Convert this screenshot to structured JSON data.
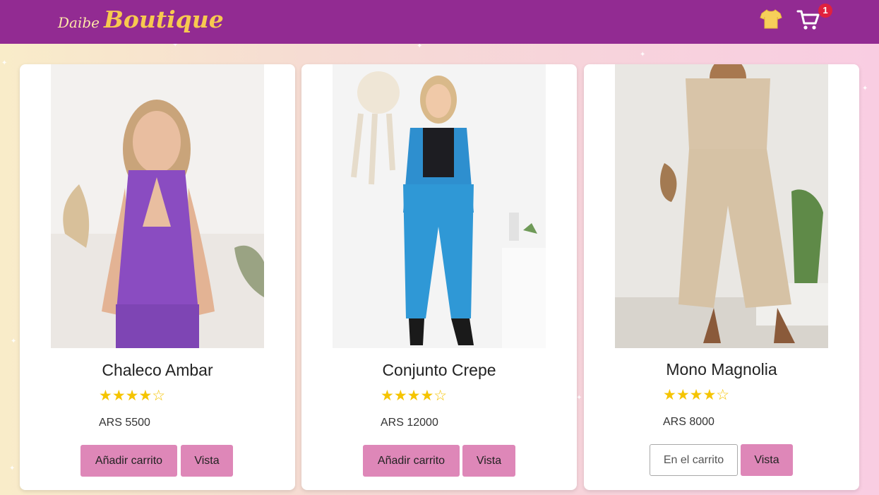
{
  "header": {
    "logo_small": "Daibe",
    "logo_big": "Boutique",
    "cart_count": "1",
    "icons": [
      "shirt-icon",
      "cart-icon"
    ]
  },
  "products": [
    {
      "name": "Chaleco Ambar",
      "rating": 4,
      "max_rating": 5,
      "stars": "★★★★☆",
      "price": "ARS 5500",
      "primary_button": "Añadir carrito",
      "view_button": "Vista",
      "in_cart": false
    },
    {
      "name": "Conjunto Crepe",
      "rating": 4,
      "max_rating": 5,
      "stars": "★★★★☆",
      "price": "ARS 12000",
      "primary_button": "Añadir carrito",
      "view_button": "Vista",
      "in_cart": false
    },
    {
      "name": "Mono Magnolia",
      "rating": 4,
      "max_rating": 5,
      "stars": "★★★★☆",
      "price": "ARS 8000",
      "primary_button": "En el carrito",
      "view_button": "Vista",
      "in_cart": true
    }
  ],
  "colors": {
    "navbar": "#922b92",
    "logo_accent": "#f7c94f",
    "button": "#de87b8",
    "badge": "#e0213e",
    "star": "#f5c400"
  }
}
